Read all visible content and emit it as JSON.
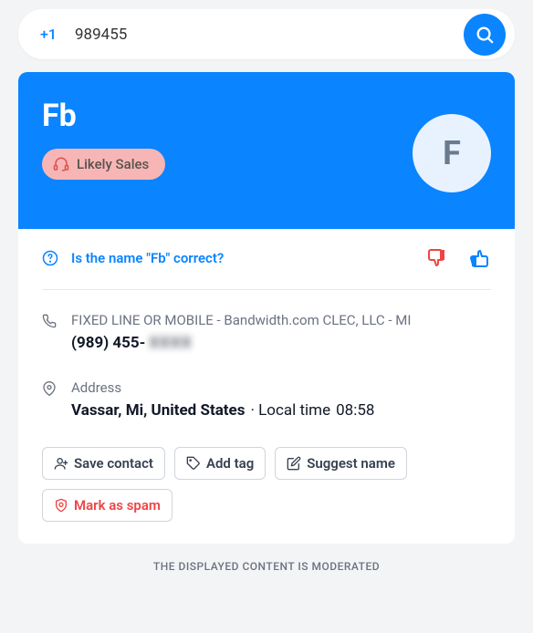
{
  "search": {
    "prefix": "+1",
    "value": "989455"
  },
  "header": {
    "name": "Fb",
    "badge": "Likely Sales",
    "avatar_letter": "F"
  },
  "verify": {
    "question": "Is the name \"Fb\" correct?"
  },
  "phone": {
    "carrier": "FIXED LINE OR MOBILE - Bandwidth.com CLEC, LLC - MI",
    "number_visible": "(989) 455-",
    "number_hidden": "XXXX"
  },
  "address": {
    "label": "Address",
    "city": "Vassar, Mi, United States",
    "time_prefix": "· Local time",
    "time": "08:58"
  },
  "actions": {
    "save": "Save contact",
    "tag": "Add tag",
    "suggest": "Suggest name",
    "spam": "Mark as spam"
  },
  "footer": "THE DISPLAYED CONTENT IS MODERATED"
}
